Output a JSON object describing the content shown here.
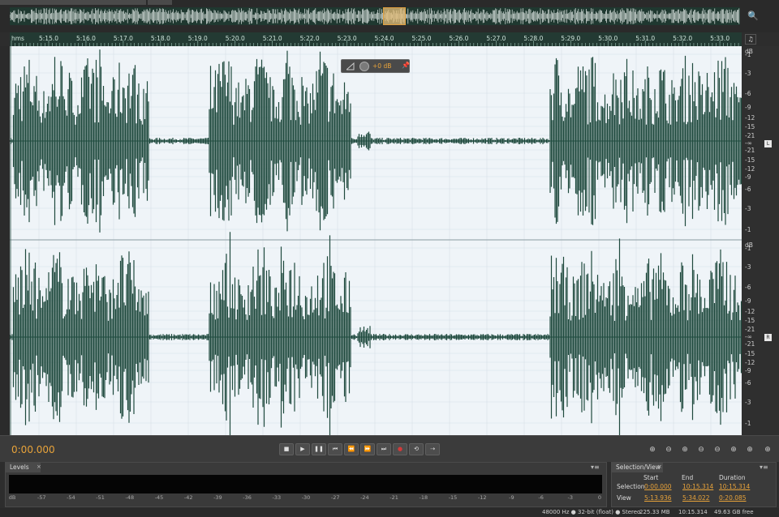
{
  "ruler": {
    "format_label": "hms",
    "ticks": [
      "5:15.0",
      "5:16.0",
      "5:17.0",
      "5:18.0",
      "5:19.0",
      "5:20.0",
      "5:21.0",
      "5:22.0",
      "5:23.0",
      "5:24.0",
      "5:25.0",
      "5:26.0",
      "5:27.0",
      "5:28.0",
      "5:29.0",
      "5:30.0",
      "5:31.0",
      "5:32.0",
      "5:33.0",
      "5:3"
    ]
  },
  "db_scale": {
    "unit": "dB",
    "labels": [
      "-1",
      "-3",
      "-6",
      "-9",
      "-12",
      "-15",
      "-21",
      "-∞",
      "-21",
      "-15",
      "-12",
      "-9",
      "-6",
      "-3",
      "-1"
    ],
    "channels": [
      "L",
      "R"
    ]
  },
  "hud": {
    "value": "+0 dB"
  },
  "transport": {
    "time": "0:00.000",
    "buttons": [
      {
        "name": "stop-button",
        "glyph": "■"
      },
      {
        "name": "play-button",
        "glyph": "▶"
      },
      {
        "name": "pause-button",
        "glyph": "❚❚"
      },
      {
        "name": "go-to-start-button",
        "glyph": "⏮"
      },
      {
        "name": "rewind-button",
        "glyph": "⏪"
      },
      {
        "name": "fast-forward-button",
        "glyph": "⏩"
      },
      {
        "name": "go-to-end-button",
        "glyph": "⏭"
      },
      {
        "name": "record-button",
        "glyph": "●"
      },
      {
        "name": "loop-button",
        "glyph": "⟲"
      },
      {
        "name": "skip-selection-button",
        "glyph": "⇢"
      }
    ],
    "zoom_buttons": [
      {
        "name": "zoom-amplitude-in-icon",
        "glyph": "⊕"
      },
      {
        "name": "zoom-amplitude-out-icon",
        "glyph": "⊖"
      },
      {
        "name": "zoom-in-time-icon",
        "glyph": "⊕"
      },
      {
        "name": "zoom-out-time-icon",
        "glyph": "⊖"
      },
      {
        "name": "zoom-out-full-icon",
        "glyph": "⊖"
      },
      {
        "name": "zoom-in-left-icon",
        "glyph": "⊕"
      },
      {
        "name": "zoom-in-right-icon",
        "glyph": "⊕"
      },
      {
        "name": "zoom-selection-icon",
        "glyph": "⊕"
      }
    ]
  },
  "levels": {
    "tab_label": "Levels",
    "scale": [
      "dB",
      "-57",
      "-54",
      "-51",
      "-48",
      "-45",
      "-42",
      "-39",
      "-36",
      "-33",
      "-30",
      "-27",
      "-24",
      "-21",
      "-18",
      "-15",
      "-12",
      "-9",
      "-6",
      "-3",
      "0"
    ]
  },
  "selection_view": {
    "tab_label": "Selection/View",
    "headers": [
      "Start",
      "End",
      "Duration"
    ],
    "rows": [
      {
        "label": "Selection",
        "start": "0:00.000",
        "end": "10:15.314",
        "duration": "10:15.314"
      },
      {
        "label": "View",
        "start": "5:13.936",
        "end": "5:34.022",
        "duration": "0:20.085"
      }
    ]
  },
  "status": {
    "format": "48000 Hz ● 32-bit (float) ● Stereo",
    "size": "225.33 MB",
    "duration": "10:15.314",
    "free": "49.63 GB free"
  },
  "colors": {
    "waveform": "#1f4a3e",
    "waveform_bg": "#eff4f8",
    "accent": "#e8a33a"
  }
}
